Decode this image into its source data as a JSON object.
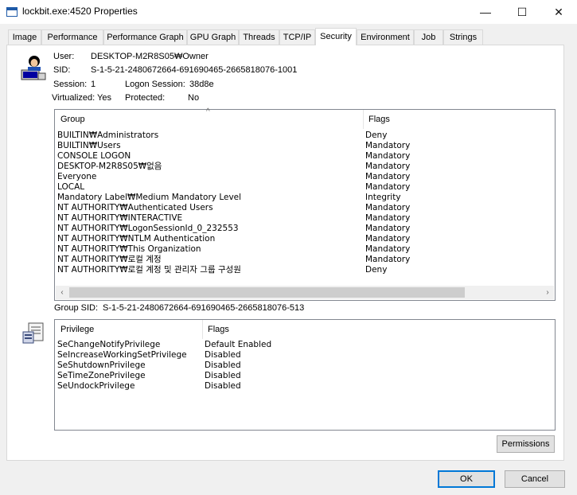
{
  "window": {
    "title": "lockbit.exe:4520 Properties",
    "minimize_glyph": "—",
    "maximize_glyph": "☐",
    "close_glyph": "✕"
  },
  "tabs": [
    {
      "label": "Image"
    },
    {
      "label": "Performance"
    },
    {
      "label": "Performance Graph"
    },
    {
      "label": "GPU Graph"
    },
    {
      "label": "Threads"
    },
    {
      "label": "TCP/IP"
    },
    {
      "label": "Security",
      "active": true
    },
    {
      "label": "Environment"
    },
    {
      "label": "Job"
    },
    {
      "label": "Strings"
    }
  ],
  "info": {
    "user_label": "User:",
    "user_value": "DESKTOP-M2R8S05₩Owner",
    "sid_label": "SID:",
    "sid_value": "S-1-5-21-2480672664-691690465-2665818076-1001",
    "session_label": "Session:",
    "session_value": "1",
    "logon_session_label": "Logon Session:",
    "logon_session_value": "38d8e",
    "virtualized_label": "Virtualized:",
    "virtualized_value": "Yes",
    "protected_label": "Protected:",
    "protected_value": "No"
  },
  "groups": {
    "col_group": "Group",
    "col_flags": "Flags",
    "rows": [
      {
        "group": "BUILTIN₩Administrators",
        "flags": "Deny"
      },
      {
        "group": "BUILTIN₩Users",
        "flags": "Mandatory"
      },
      {
        "group": "CONSOLE LOGON",
        "flags": "Mandatory"
      },
      {
        "group": "DESKTOP-M2R8S05₩없음",
        "flags": "Mandatory"
      },
      {
        "group": "Everyone",
        "flags": "Mandatory"
      },
      {
        "group": "LOCAL",
        "flags": "Mandatory"
      },
      {
        "group": "Mandatory Label₩Medium Mandatory Level",
        "flags": "Integrity"
      },
      {
        "group": "NT AUTHORITY₩Authenticated Users",
        "flags": "Mandatory"
      },
      {
        "group": "NT AUTHORITY₩INTERACTIVE",
        "flags": "Mandatory"
      },
      {
        "group": "NT AUTHORITY₩LogonSessionId_0_232553",
        "flags": "Mandatory"
      },
      {
        "group": "NT AUTHORITY₩NTLM Authentication",
        "flags": "Mandatory"
      },
      {
        "group": "NT AUTHORITY₩This Organization",
        "flags": "Mandatory"
      },
      {
        "group": "NT AUTHORITY₩로컬 계정",
        "flags": "Mandatory"
      },
      {
        "group": "NT AUTHORITY₩로컬 계정 및 관리자 그룹 구성원",
        "flags": "Deny"
      }
    ]
  },
  "group_sid": {
    "label": "Group SID:",
    "value": "S-1-5-21-2480672664-691690465-2665818076-513"
  },
  "privileges": {
    "col_privilege": "Privilege",
    "col_flags": "Flags",
    "rows": [
      {
        "privilege": "SeChangeNotifyPrivilege",
        "flags": "Default Enabled"
      },
      {
        "privilege": "SeIncreaseWorkingSetPrivilege",
        "flags": "Disabled"
      },
      {
        "privilege": "SeShutdownPrivilege",
        "flags": "Disabled"
      },
      {
        "privilege": "SeTimeZonePrivilege",
        "flags": "Disabled"
      },
      {
        "privilege": "SeUndockPrivilege",
        "flags": "Disabled"
      }
    ]
  },
  "buttons": {
    "permissions": "Permissions",
    "ok": "OK",
    "cancel": "Cancel"
  },
  "colors": {
    "accent": "#0078d7",
    "panel": "#ffffff",
    "chrome": "#f0f0f0"
  },
  "icons": {
    "app": "window-icon",
    "user": "user-at-computer-icon",
    "privilege": "document-certificate-icon",
    "sort": "sort-ascending-icon"
  }
}
